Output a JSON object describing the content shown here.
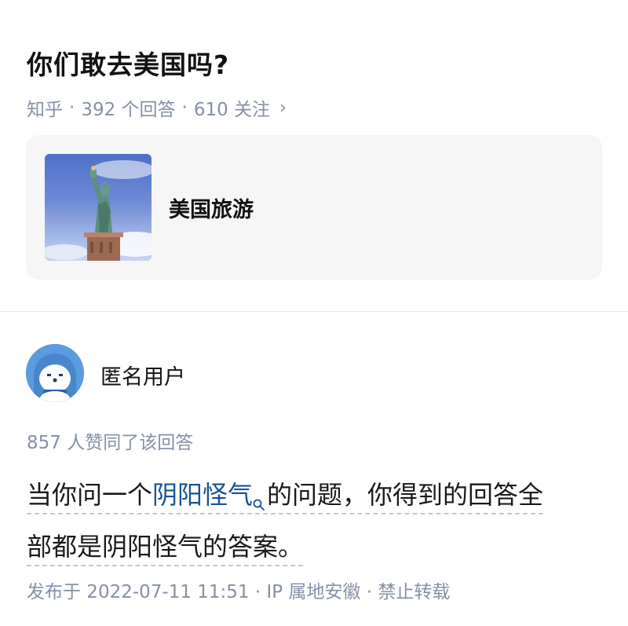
{
  "question": {
    "title": "你们敢去美国吗?",
    "source": "知乎",
    "answers_count": "392 个回答",
    "followers_count": "610 关注",
    "separator": "·"
  },
  "topic": {
    "name": "美国旅游",
    "thumbnail_icon": "statue-of-liberty-image"
  },
  "answer": {
    "author": "匿名用户",
    "votes_text": "857 人赞同了该回答",
    "text_before_link": "当你问一个",
    "link_keyword": "阴阳怪气",
    "text_after_link_line1": "的问题，你得到的回答全",
    "text_line2": "部都是阴阳怪气的答案。",
    "published": "发布于 2022-07-11 11:51",
    "ip_location": "IP 属地安徽",
    "reprint": "禁止转载"
  },
  "colors": {
    "link": "#175199",
    "meta_gray": "#8590a6",
    "card_bg": "#f6f6f6",
    "avatar_blue": "#5b9be0"
  }
}
